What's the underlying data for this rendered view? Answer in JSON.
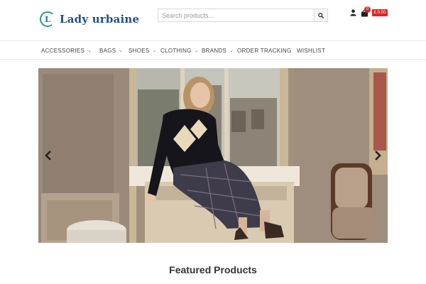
{
  "header": {
    "logo_letter": "L",
    "logo_text": "Lady urbaine",
    "search_placeholder": "Search products...",
    "cart_count": "0",
    "cart_total": "£ 0.00"
  },
  "nav": {
    "items": [
      {
        "label": "ACCESSORIES",
        "has_dropdown": true
      },
      {
        "label": "BAGS",
        "has_dropdown": true
      },
      {
        "label": "SHOES",
        "has_dropdown": true
      },
      {
        "label": "CLOTHING",
        "has_dropdown": true
      },
      {
        "label": "BRANDS",
        "has_dropdown": true
      },
      {
        "label": "ORDER TRACKING",
        "has_dropdown": false
      },
      {
        "label": "WISHLIST",
        "has_dropdown": false
      }
    ]
  },
  "icons": {
    "search": "magnifier-icon",
    "user": "user-icon",
    "cart": "shopping-bag-icon",
    "prev": "chevron-left-icon",
    "next": "chevron-right-icon"
  },
  "colors": {
    "accent_red": "#e02424",
    "logo_blue": "#1e4e8c",
    "logo_teal": "#2c9b8c"
  },
  "main": {
    "section_title": "Featured Products"
  }
}
